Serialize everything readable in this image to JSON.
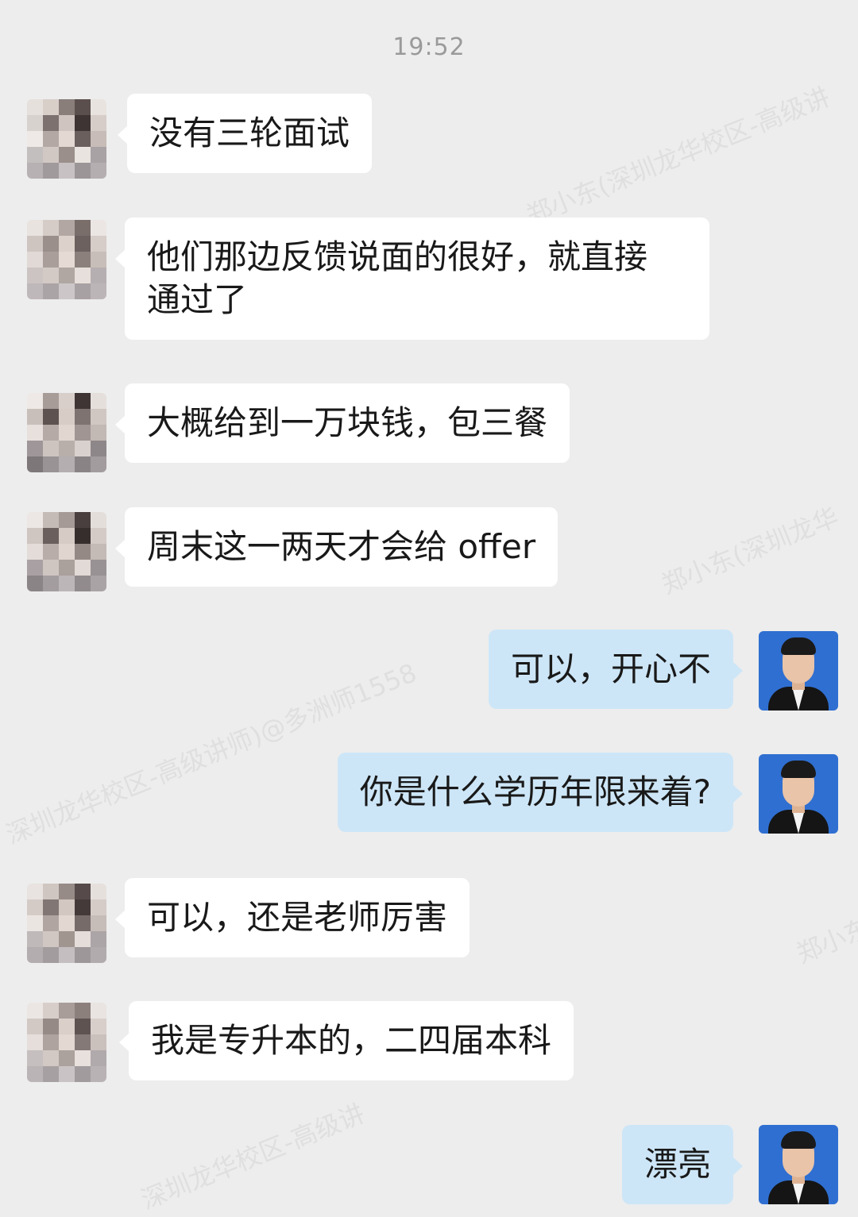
{
  "timestamp": "19:52",
  "watermarks": [
    "郑小东(深圳龙华校区-高级讲",
    "郑小东(深圳龙华",
    "深圳龙华校区-高级讲师)@多洲师1558",
    "郑小东",
    "深圳龙华校区-高级讲"
  ],
  "messages": [
    {
      "side": "in",
      "text": "没有三轮面试"
    },
    {
      "side": "in",
      "text": "他们那边反馈说面的很好，就直接\n通过了"
    },
    {
      "side": "in",
      "text": "大概给到一万块钱，包三餐"
    },
    {
      "side": "in",
      "text": "周末这一两天才会给 offer"
    },
    {
      "side": "out",
      "text": "可以，开心不"
    },
    {
      "side": "out",
      "text": "你是什么学历年限来着?"
    },
    {
      "side": "in",
      "text": "可以，还是老师厉害"
    },
    {
      "side": "in",
      "text": "我是专升本的，二四届本科"
    },
    {
      "side": "out",
      "text": "漂亮"
    }
  ],
  "avatars": {
    "contact": "blurred-contact-avatar",
    "self": "portrait-avatar"
  },
  "colors": {
    "background": "#ededed",
    "incoming_bubble": "#ffffff",
    "outgoing_bubble": "#cde6f7",
    "timestamp_text": "#9a9a9a"
  }
}
